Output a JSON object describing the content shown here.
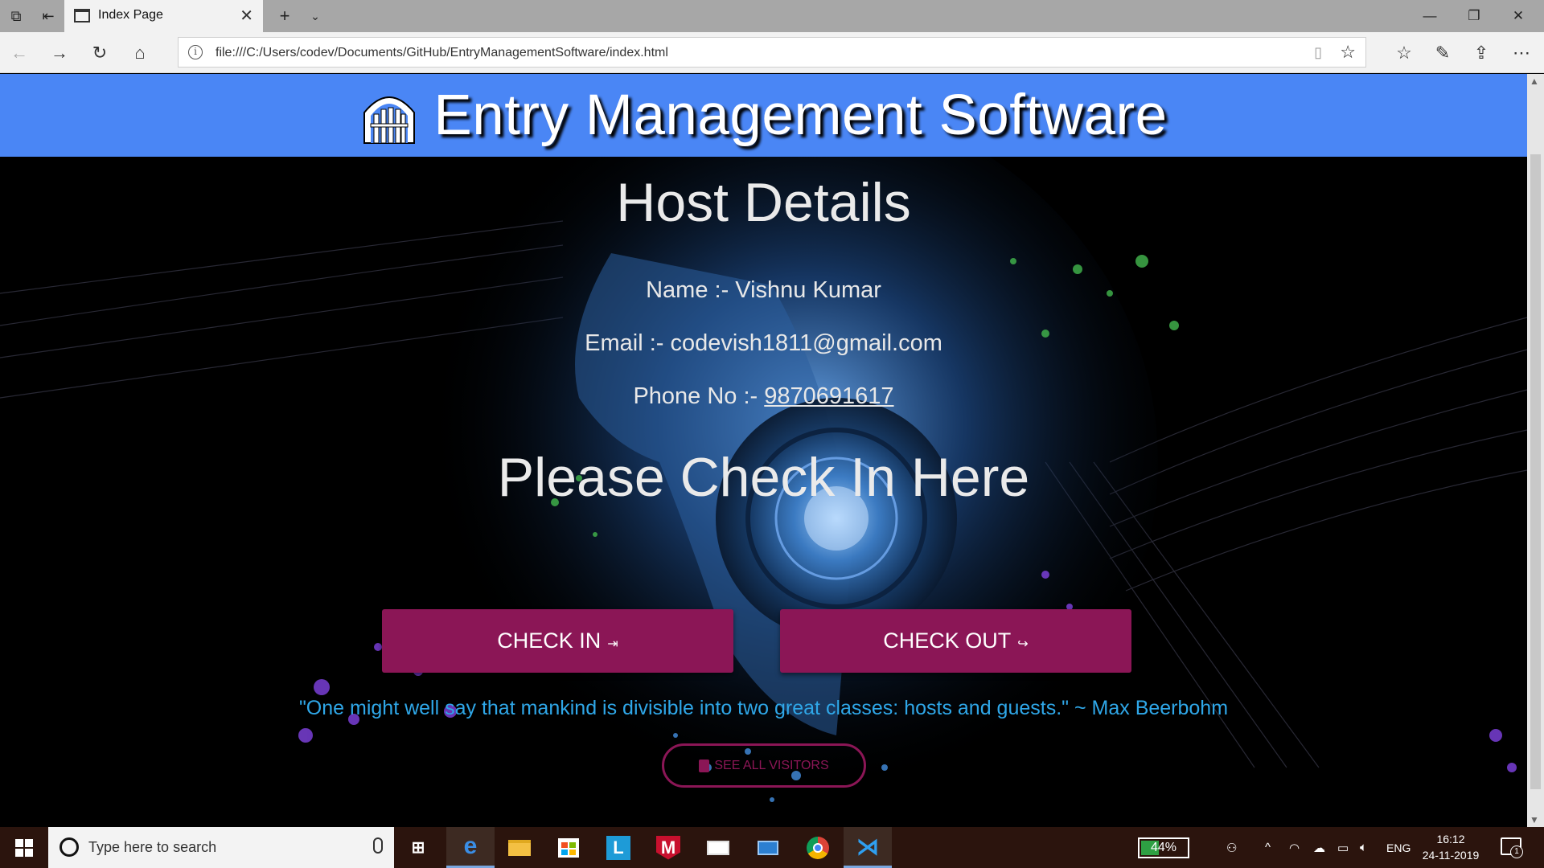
{
  "browser": {
    "tab_title": "Index Page",
    "url": "file:///C:/Users/codev/Documents/GitHub/EntryManagementSoftware/index.html"
  },
  "site": {
    "title": "Entry Management Software",
    "host_heading": "Host Details",
    "host_name_label": "Name :- ",
    "host_name": "Vishnu Kumar",
    "host_email_label": "Email :- ",
    "host_email": "codevish1811@gmail.com",
    "host_phone_label": "Phone No :- ",
    "host_phone": "9870691617",
    "checkin_heading": "Please Check In Here",
    "check_in_label": "CHECK IN",
    "check_out_label": "CHECK OUT",
    "quote": "\"One might well say that mankind is divisible into two great classes: hosts and guests.\" ~ Max Beerbohm",
    "see_visitors_label": "SEE ALL VISITORS",
    "colors": {
      "header": "#4a86f5",
      "button": "#8b1656",
      "quote": "#2fa7e8"
    }
  },
  "taskbar": {
    "search_placeholder": "Type here to search",
    "battery": "44%",
    "battery_level": 0.44,
    "language": "ENG",
    "time": "16:12",
    "date": "24-11-2019",
    "notifications": "1"
  }
}
